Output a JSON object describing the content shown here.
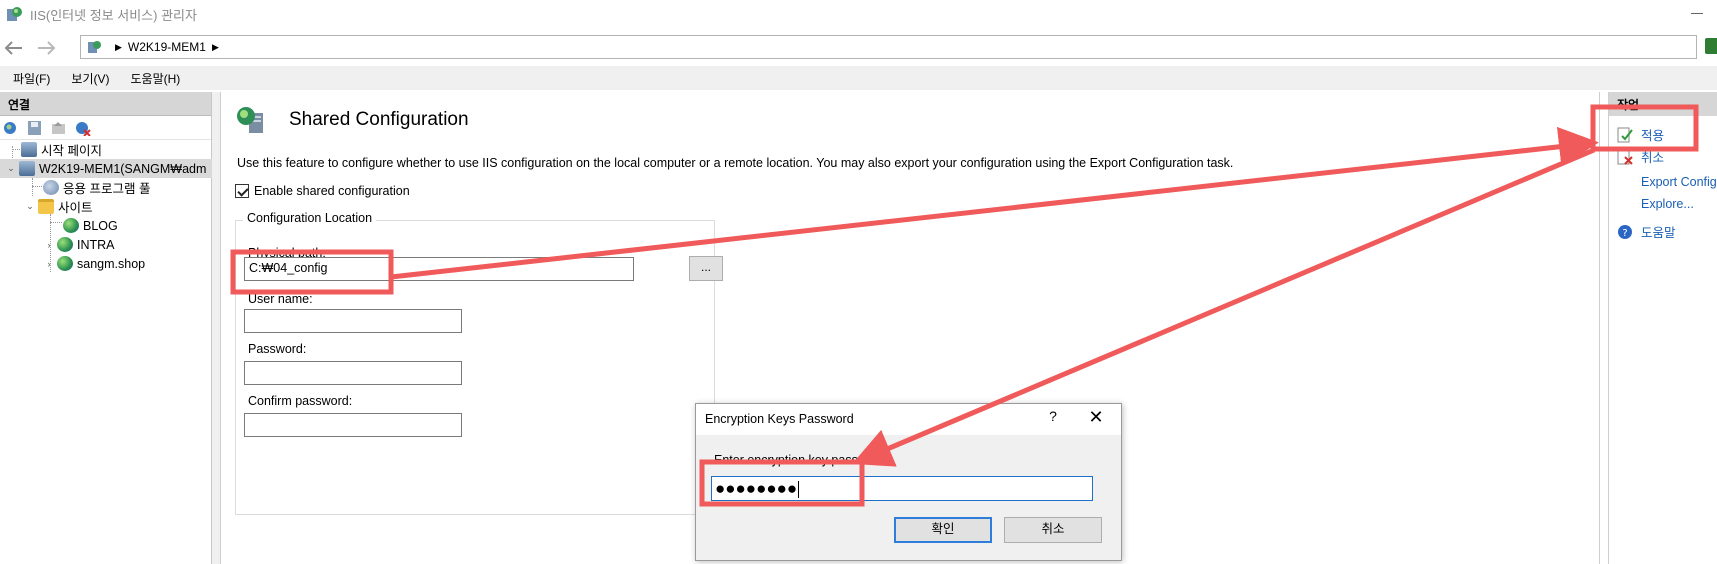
{
  "window": {
    "title": "IIS(인터넷 정보 서비스) 관리자"
  },
  "address_bar": {
    "crumbs": [
      "W2K19-MEM1"
    ]
  },
  "menu": [
    "파일(F)",
    "보기(V)",
    "도움말(H)"
  ],
  "connections": {
    "header": "연결",
    "tree": [
      {
        "label": "시작 페이지",
        "icon": "start-page-icon"
      },
      {
        "label": "W2K19-MEM1(SANGM₩adm",
        "icon": "server-icon",
        "selected": true
      },
      {
        "label": "응용 프로그램 풀",
        "icon": "app-pool-icon"
      },
      {
        "label": "사이트",
        "icon": "folder-icon"
      },
      {
        "label": "BLOG",
        "icon": "globe-icon"
      },
      {
        "label": "INTRA",
        "icon": "globe-icon"
      },
      {
        "label": "sangm.shop",
        "icon": "globe-icon"
      }
    ]
  },
  "feature": {
    "title": "Shared Configuration",
    "description": "Use this feature to configure whether to use IIS configuration on the local computer or a remote location. You may also export your configuration using the Export Configuration task.",
    "enable_label": "Enable shared configuration",
    "enable_checked": true,
    "group_label": "Configuration Location",
    "physical_path_label": "Physical path:",
    "physical_path_value": "C:₩04_config",
    "browse_label": "...",
    "user_name_label": "User name:",
    "user_name_value": "",
    "password_label": "Password:",
    "password_value": "",
    "confirm_password_label": "Confirm password:",
    "confirm_password_value": ""
  },
  "actions": {
    "header": "작업",
    "apply": "적용",
    "cancel": "취소",
    "export": "Export Config",
    "explore": "Explore...",
    "help": "도움말"
  },
  "dialog": {
    "title": "Encryption Keys Password",
    "help": "?",
    "close": "✕",
    "label": "Enter encryption key password:",
    "value": "●●●●●●●●",
    "ok": "확인",
    "cancel": "취소"
  },
  "colors": {
    "annotation": "#f05a5a",
    "link": "#1a5fb4",
    "focus": "#1e70c8"
  }
}
